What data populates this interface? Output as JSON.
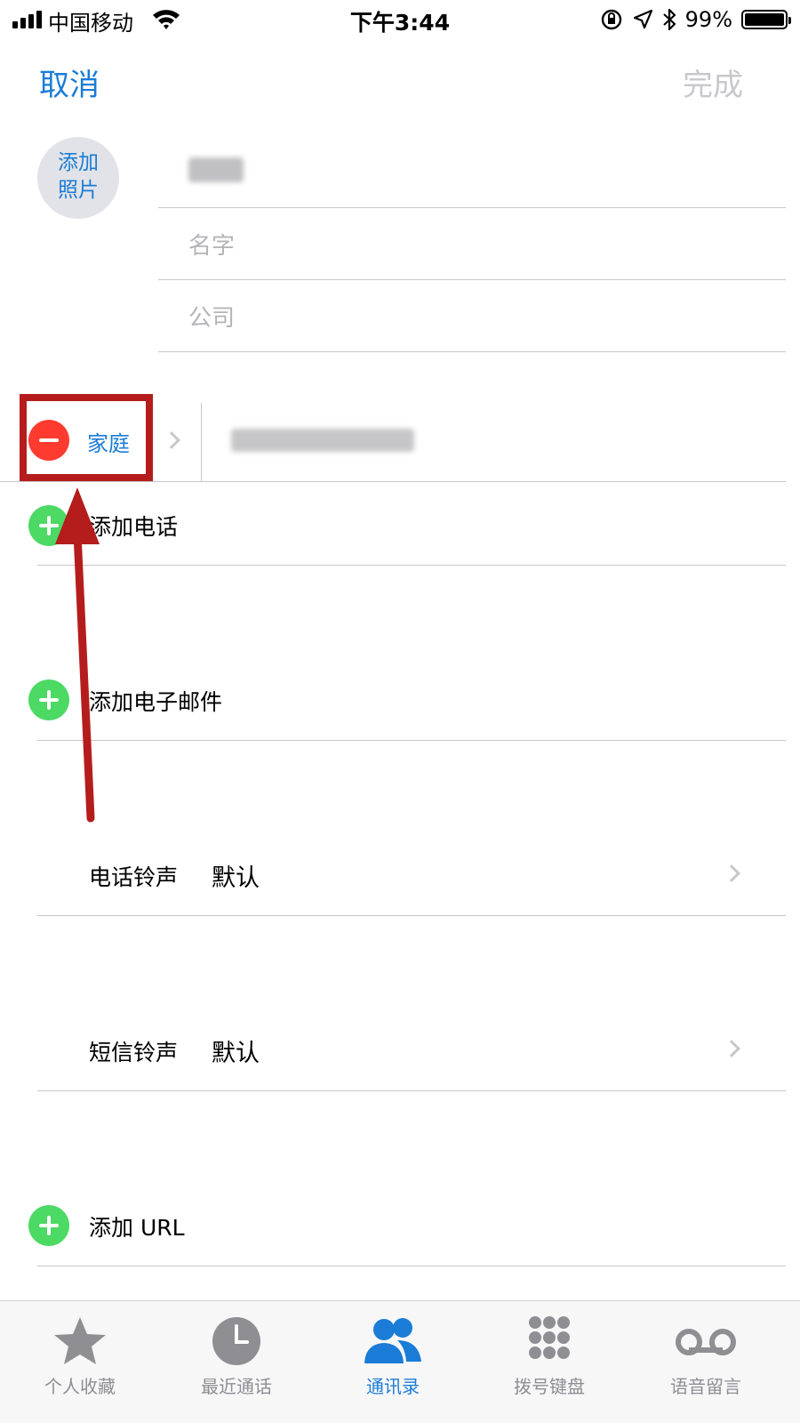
{
  "status_bar": {
    "carrier": "中国移动",
    "time": "下午3:44",
    "battery_percent": "99%",
    "battery_level": 0.99,
    "signal_bars": 4,
    "icons": [
      "signal-icon",
      "wifi-icon",
      "rotation-lock-icon",
      "location-arrow-icon",
      "bluetooth-icon",
      "battery-icon"
    ]
  },
  "nav": {
    "cancel": "取消",
    "done": "完成"
  },
  "avatar": {
    "label": "添加\n照片"
  },
  "fields": {
    "company_placeholder": "公司",
    "first_name_placeholder": "名字"
  },
  "phone": {
    "label": "家庭"
  },
  "actions": {
    "add_phone": "添加电话",
    "add_email": "添加电子邮件",
    "add_url": "添加 URL"
  },
  "ringtone": {
    "label": "电话铃声",
    "value": "默认"
  },
  "text_tone": {
    "label": "短信铃声",
    "value": "默认"
  },
  "tabs": [
    {
      "label": "个人收藏",
      "icon": "star-icon",
      "active": false
    },
    {
      "label": "最近通话",
      "icon": "clock-icon",
      "active": false
    },
    {
      "label": "通讯录",
      "icon": "contacts-icon",
      "active": true
    },
    {
      "label": "拨号键盘",
      "icon": "keypad-icon",
      "active": false
    },
    {
      "label": "语音留言",
      "icon": "voicemail-icon",
      "active": false
    }
  ],
  "colors": {
    "accent": "#1a7cd6",
    "delete": "#ff3b30",
    "add": "#4cd964",
    "annotation": "#b51d1d"
  }
}
